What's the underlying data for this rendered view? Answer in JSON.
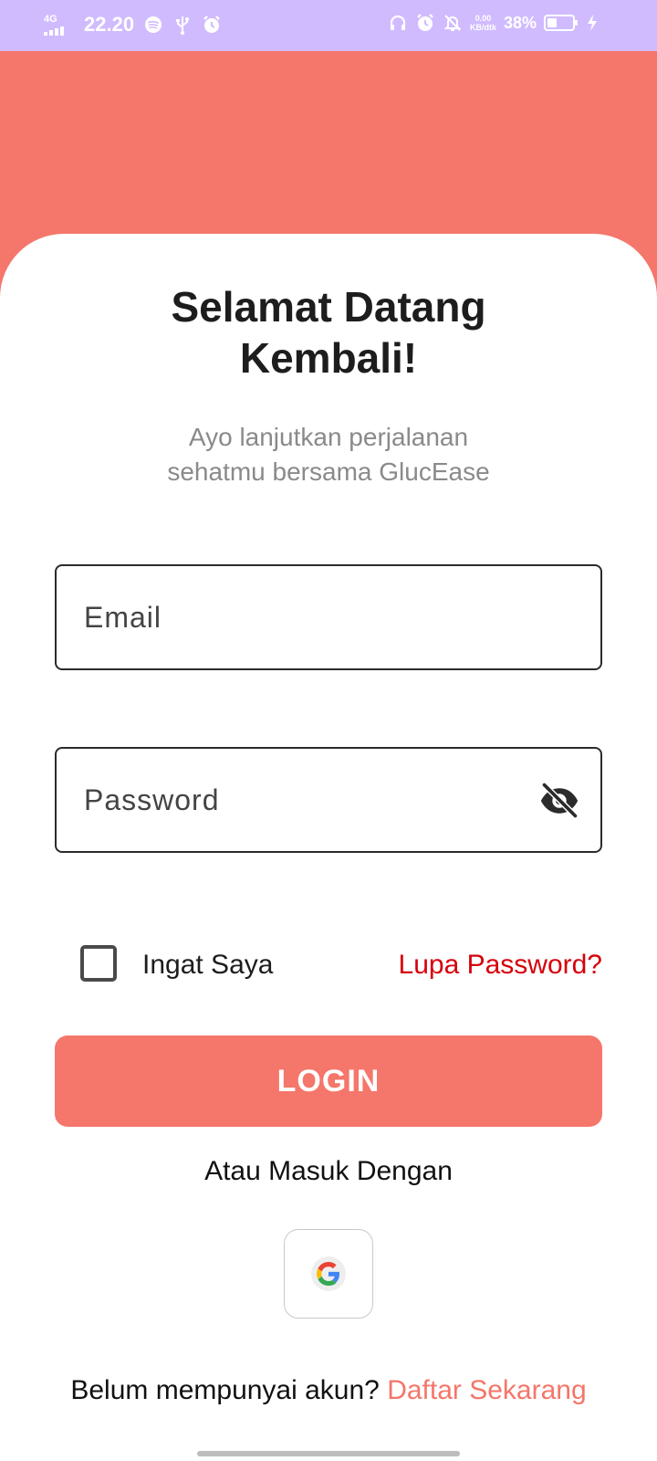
{
  "status_bar": {
    "network": "4G",
    "time": "22.20",
    "speed_value": "0.00",
    "speed_unit": "KB/dtk",
    "battery_percent": "38%",
    "battery_level": 0.38,
    "icons_left": [
      "spotify-icon",
      "usb-icon",
      "alarm-icon"
    ],
    "icons_right": [
      "headphones-icon",
      "alarm-icon",
      "mute-notifications-icon",
      "battery-icon",
      "charging-icon"
    ],
    "color": "#d0bbff"
  },
  "header": {
    "color": "#f5766a"
  },
  "login": {
    "title_line1": "Selamat Datang",
    "title_line2": "Kembali!",
    "subtitle_line1": "Ayo lanjutkan perjalanan",
    "subtitle_line2": "sehatmu bersama GlucEase",
    "email": {
      "value": "",
      "placeholder": "Email"
    },
    "password": {
      "value": "",
      "placeholder": "Password",
      "toggle_icon": "eye-off-icon"
    },
    "remember_me": {
      "label": "Ingat Saya",
      "checked": false
    },
    "forgot_password": "Lupa Password?",
    "login_button": "LOGIN",
    "or_text": "Atau Masuk Dengan",
    "google_icon": "google-icon",
    "register_prompt": "Belum mempunyai akun?",
    "register_link": "Daftar Sekarang"
  },
  "colors": {
    "accent": "#f5766a",
    "link_red": "#d6000a"
  }
}
